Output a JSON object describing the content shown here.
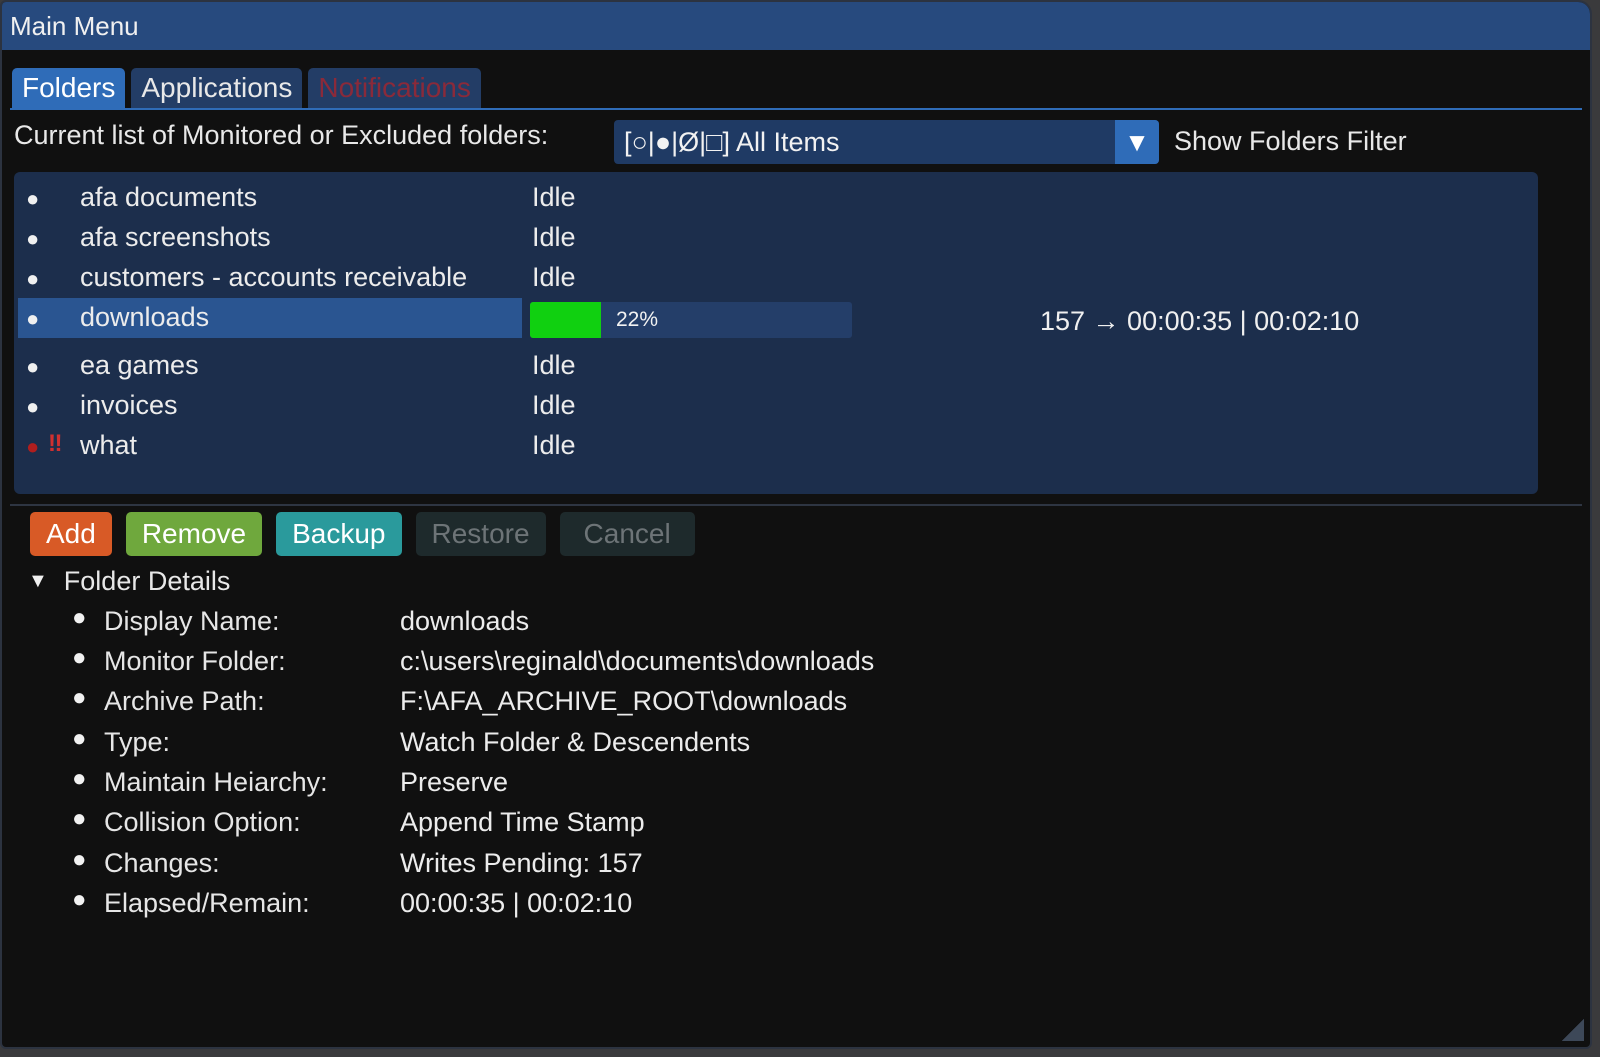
{
  "window": {
    "title": "Main Menu"
  },
  "tabs": [
    {
      "label": "Folders",
      "state": "active"
    },
    {
      "label": "Applications",
      "state": "normal"
    },
    {
      "label": "Notifications",
      "state": "disabled"
    }
  ],
  "filter": {
    "label": "Current list of Monitored or Excluded folders:",
    "selected": "[○|●|Ø|□] All Items",
    "caption": "Show Folders Filter"
  },
  "folders": [
    {
      "bullet": "●",
      "warn": "",
      "name": "afa documents",
      "status": "Idle"
    },
    {
      "bullet": "●",
      "warn": "",
      "name": "afa screenshots",
      "status": "Idle"
    },
    {
      "bullet": "●",
      "warn": "",
      "name": "customers - accounts receivable",
      "status": "Idle"
    },
    {
      "bullet": "●",
      "warn": "",
      "name": "downloads",
      "status": "",
      "selected": true,
      "progress_pct": 22,
      "progress_label": "22%",
      "info": "157 → 00:00:35 | 00:02:10"
    },
    {
      "bullet": "●",
      "warn": "",
      "name": "ea games",
      "status": "Idle"
    },
    {
      "bullet": "●",
      "warn": "",
      "name": "invoices",
      "status": "Idle"
    },
    {
      "bullet": "●",
      "warn": "‼",
      "name": "what",
      "status": "Idle",
      "bullet_color": "#b01e1e"
    }
  ],
  "buttons": {
    "add": "Add",
    "remove": "Remove",
    "backup": "Backup",
    "restore": "Restore",
    "cancel": "Cancel"
  },
  "details": {
    "header": "Folder Details",
    "items": [
      {
        "label": "Display Name:",
        "value": "downloads"
      },
      {
        "label": "Monitor Folder:",
        "value": "c:\\users\\reginald\\documents\\downloads"
      },
      {
        "label": "Archive Path:",
        "value": "F:\\AFA_ARCHIVE_ROOT\\downloads"
      },
      {
        "label": "Type:",
        "value": "Watch Folder & Descendents"
      },
      {
        "label": "Maintain Heiarchy:",
        "value": "Preserve"
      },
      {
        "label": "Collision Option:",
        "value": "Append Time Stamp"
      },
      {
        "label": "Changes:",
        "value": "Writes Pending: 157"
      },
      {
        "label": "Elapsed/Remain:",
        "value": "00:00:35 | 00:02:10"
      }
    ]
  },
  "colors": {
    "titlebar": "#274a7e",
    "tab_active": "#2f6cb8",
    "list_bg": "#1c2e4c",
    "progress_fill": "#10d010",
    "add": "#d85a26",
    "remove": "#6fa83d",
    "backup": "#2a9a9c"
  }
}
